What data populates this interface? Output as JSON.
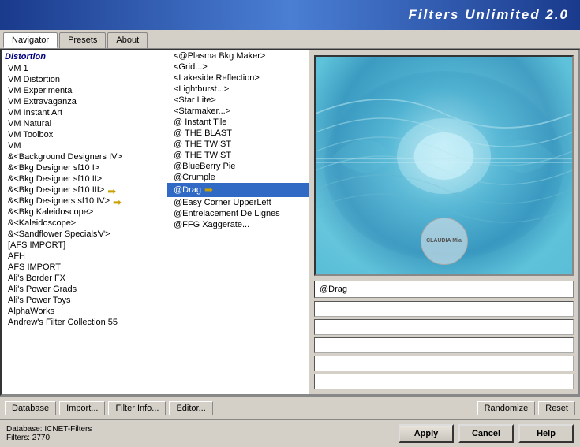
{
  "title": "Filters Unlimited 2.0",
  "tabs": [
    {
      "label": "Navigator",
      "active": true
    },
    {
      "label": "Presets",
      "active": false
    },
    {
      "label": "About",
      "active": false
    }
  ],
  "list": {
    "items": [
      {
        "text": "VM 1",
        "selected": false,
        "arrow": false
      },
      {
        "text": "VM Distortion",
        "selected": false,
        "arrow": false
      },
      {
        "text": "VM Experimental",
        "selected": false,
        "arrow": false
      },
      {
        "text": "VM Extravaganza",
        "selected": false,
        "arrow": false
      },
      {
        "text": "VM Instant Art",
        "selected": false,
        "arrow": false
      },
      {
        "text": "VM Natural",
        "selected": false,
        "arrow": false
      },
      {
        "text": "VM Toolbox",
        "selected": false,
        "arrow": false
      },
      {
        "text": "VM",
        "selected": false,
        "arrow": false
      },
      {
        "text": "&<Background Designers IV>",
        "selected": false,
        "arrow": false
      },
      {
        "text": "&<Bkg Designer sf10 I>",
        "selected": false,
        "arrow": false
      },
      {
        "text": "&<Bkg Designer sf10 II>",
        "selected": false,
        "arrow": false
      },
      {
        "text": "&<Bkg Designer sf10 III>",
        "selected": false,
        "arrow": true
      },
      {
        "text": "&<Bkg Designers sf10 IV>",
        "selected": false,
        "arrow": true
      },
      {
        "text": "&<Bkg Kaleidoscope>",
        "selected": false,
        "arrow": false
      },
      {
        "text": "&<Kaleidoscope>",
        "selected": false,
        "arrow": false
      },
      {
        "text": "&<Sandflower Specials'v'>",
        "selected": false,
        "arrow": false
      },
      {
        "text": "[AFS IMPORT]",
        "selected": false,
        "arrow": false
      },
      {
        "text": "AFH",
        "selected": false,
        "arrow": false
      },
      {
        "text": "AFS IMPORT",
        "selected": false,
        "arrow": false
      },
      {
        "text": "Ali's Border FX",
        "selected": false,
        "arrow": false
      },
      {
        "text": "Ali's Power Grads",
        "selected": false,
        "arrow": false
      },
      {
        "text": "Ali's Power Toys",
        "selected": false,
        "arrow": false
      },
      {
        "text": "AlphaWorks",
        "selected": false,
        "arrow": false
      },
      {
        "text": "Andrew's Filter Collection 55",
        "selected": false,
        "arrow": false
      }
    ]
  },
  "right_list": {
    "items": [
      {
        "text": "<@Plasma Bkg Maker>",
        "selected": false
      },
      {
        "text": "<Grid...>",
        "selected": false
      },
      {
        "text": "<Lakeside Reflection>",
        "selected": false
      },
      {
        "text": "<Lightburst...>",
        "selected": false
      },
      {
        "text": "<Star Lite>",
        "selected": false
      },
      {
        "text": "<Starmaker...>",
        "selected": false
      },
      {
        "text": "@ Instant Tile",
        "selected": false
      },
      {
        "text": "@ THE BLAST",
        "selected": false
      },
      {
        "text": "@ THE TWIST",
        "selected": false
      },
      {
        "text": "@ THE TWIST",
        "selected": false
      },
      {
        "text": "@BlueBerry Pie",
        "selected": false
      },
      {
        "text": "@Crumple",
        "selected": false
      },
      {
        "text": "@Drag",
        "selected": true
      },
      {
        "text": "@Easy Corner UpperLeft",
        "selected": false
      },
      {
        "text": "@Entrelacement De Lignes",
        "selected": false
      },
      {
        "text": "@FFG Xaggerate...",
        "selected": false
      }
    ]
  },
  "section_label": "Distortion",
  "filter_name": "@Drag",
  "preview_watermark": "CLAUDIA\nMia",
  "toolbar": {
    "database": "Database",
    "import": "Import...",
    "filter_info": "Filter Info...",
    "editor": "Editor...",
    "randomize": "Randomize",
    "reset": "Reset"
  },
  "status": {
    "database_label": "Database:",
    "database_value": "ICNET-Filters",
    "filters_label": "Filters:",
    "filters_value": "2770"
  },
  "buttons": {
    "apply": "Apply",
    "cancel": "Cancel",
    "help": "Help"
  }
}
